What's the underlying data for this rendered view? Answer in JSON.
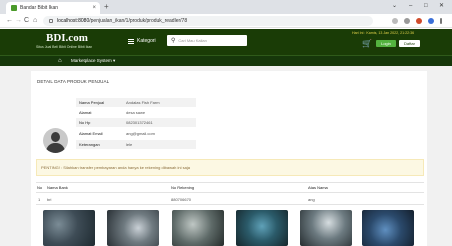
{
  "browser": {
    "tab_title": "Bandar Bibit Ikan",
    "tab_close": "×",
    "new_tab": "+",
    "window_controls": [
      "⌄",
      "–",
      "□",
      "✕"
    ],
    "nav": [
      "←",
      "→",
      "C",
      "⌂"
    ],
    "url_host": "localhost:8080",
    "url_path": "/penjualan_ikan/1/produk/produk_readler/78"
  },
  "header": {
    "brand": "BDI.com",
    "tagline": "Situs Jual Beli Bibit Online Bibit Ikan",
    "category_label": "Kategori",
    "search_placeholder": "Cari Mau Kalian",
    "datetime": "Hari Ini : Kamis, 13 Jan 2022, 21:22:36",
    "login_label": "Login",
    "register_label": "Daftar",
    "colors": {
      "header_bg": "#1a3c06",
      "accent_green": "#54b33f",
      "datetime": "#e4d44a"
    }
  },
  "subnav": {
    "home_icon": "⌂",
    "marketplace_label": "Marketplace System ▾"
  },
  "seller": {
    "section_title": "DETAIL DATA PRODUK PENJUAL",
    "rows": [
      {
        "label": "Nama Penjual",
        "value": "Andalas Fish Farm"
      },
      {
        "label": "Alamat",
        "value": "desa sawe"
      },
      {
        "label": "No Hp",
        "value": "082301372461"
      },
      {
        "label": "Alamat Email",
        "value": "ang@gmail.com"
      },
      {
        "label": "Keterangan",
        "value": "lele"
      }
    ]
  },
  "notice": {
    "text": "PENTING! : Silahkan transfer pembayaran anda hanya ke rekening dibawah ini saja"
  },
  "bank_table": {
    "headers": [
      "No",
      "Nama Bank",
      "No Rekening",
      "Atas Nama"
    ],
    "rows": [
      [
        "1",
        "bri",
        "880706670",
        "ang"
      ]
    ]
  }
}
